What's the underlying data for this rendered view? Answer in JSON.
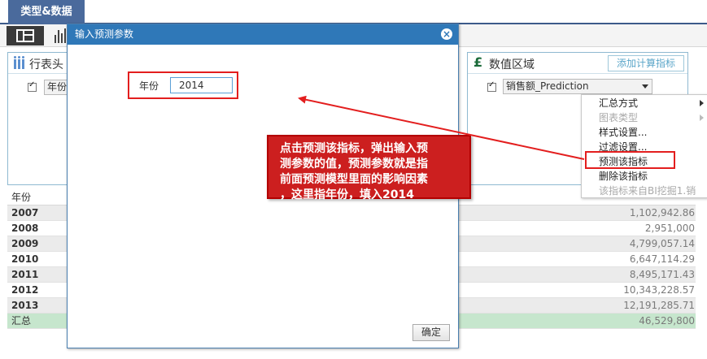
{
  "top_tab": {
    "label": "类型&数据"
  },
  "row_header": {
    "title": "行表头",
    "fields": [
      {
        "label": "年份"
      }
    ]
  },
  "value_area": {
    "title": "数值区域",
    "add_button": "添加计算指标",
    "fields": [
      {
        "label": "销售额_Prediction"
      }
    ]
  },
  "table": {
    "header": "年份",
    "rows": [
      {
        "year": "2007",
        "value": "1,102,942.86"
      },
      {
        "year": "2008",
        "value": "2,951,000"
      },
      {
        "year": "2009",
        "value": "4,799,057.14"
      },
      {
        "year": "2010",
        "value": "6,647,114.29"
      },
      {
        "year": "2011",
        "value": "8,495,171.43"
      },
      {
        "year": "2012",
        "value": "10,343,228.57"
      },
      {
        "year": "2013",
        "value": "12,191,285.71"
      }
    ],
    "total": {
      "label": "汇总",
      "value": "46,529,800"
    }
  },
  "dialog": {
    "title": "输入预测参数",
    "param_label": "年份",
    "param_value": "2014",
    "ok": "确定"
  },
  "context_menu": {
    "items": [
      {
        "label": "汇总方式",
        "disabled": false,
        "submenu": true
      },
      {
        "label": "图表类型",
        "disabled": true,
        "submenu": true
      },
      {
        "label": "样式设置...",
        "disabled": false,
        "submenu": false
      },
      {
        "label": "过滤设置...",
        "disabled": false,
        "submenu": false
      },
      {
        "label": "预测该指标",
        "disabled": false,
        "submenu": false
      },
      {
        "label": "删除该指标",
        "disabled": false,
        "submenu": false
      },
      {
        "label": "该指标来自BI挖掘1.销",
        "disabled": true,
        "submenu": false
      }
    ]
  },
  "annotation": {
    "lines": [
      "点击预测该指标，弹出输入预",
      "测参数的值，预测参数就是指",
      "前面预测模型里面的影响因素",
      "，这里指年份，填入2014"
    ]
  },
  "colors": {
    "annotation_red": "#cc1f1f",
    "dialog_title_blue": "#2f78b8",
    "total_row_green": "#c6e6cd",
    "tab_blue": "#4a6a9c"
  }
}
